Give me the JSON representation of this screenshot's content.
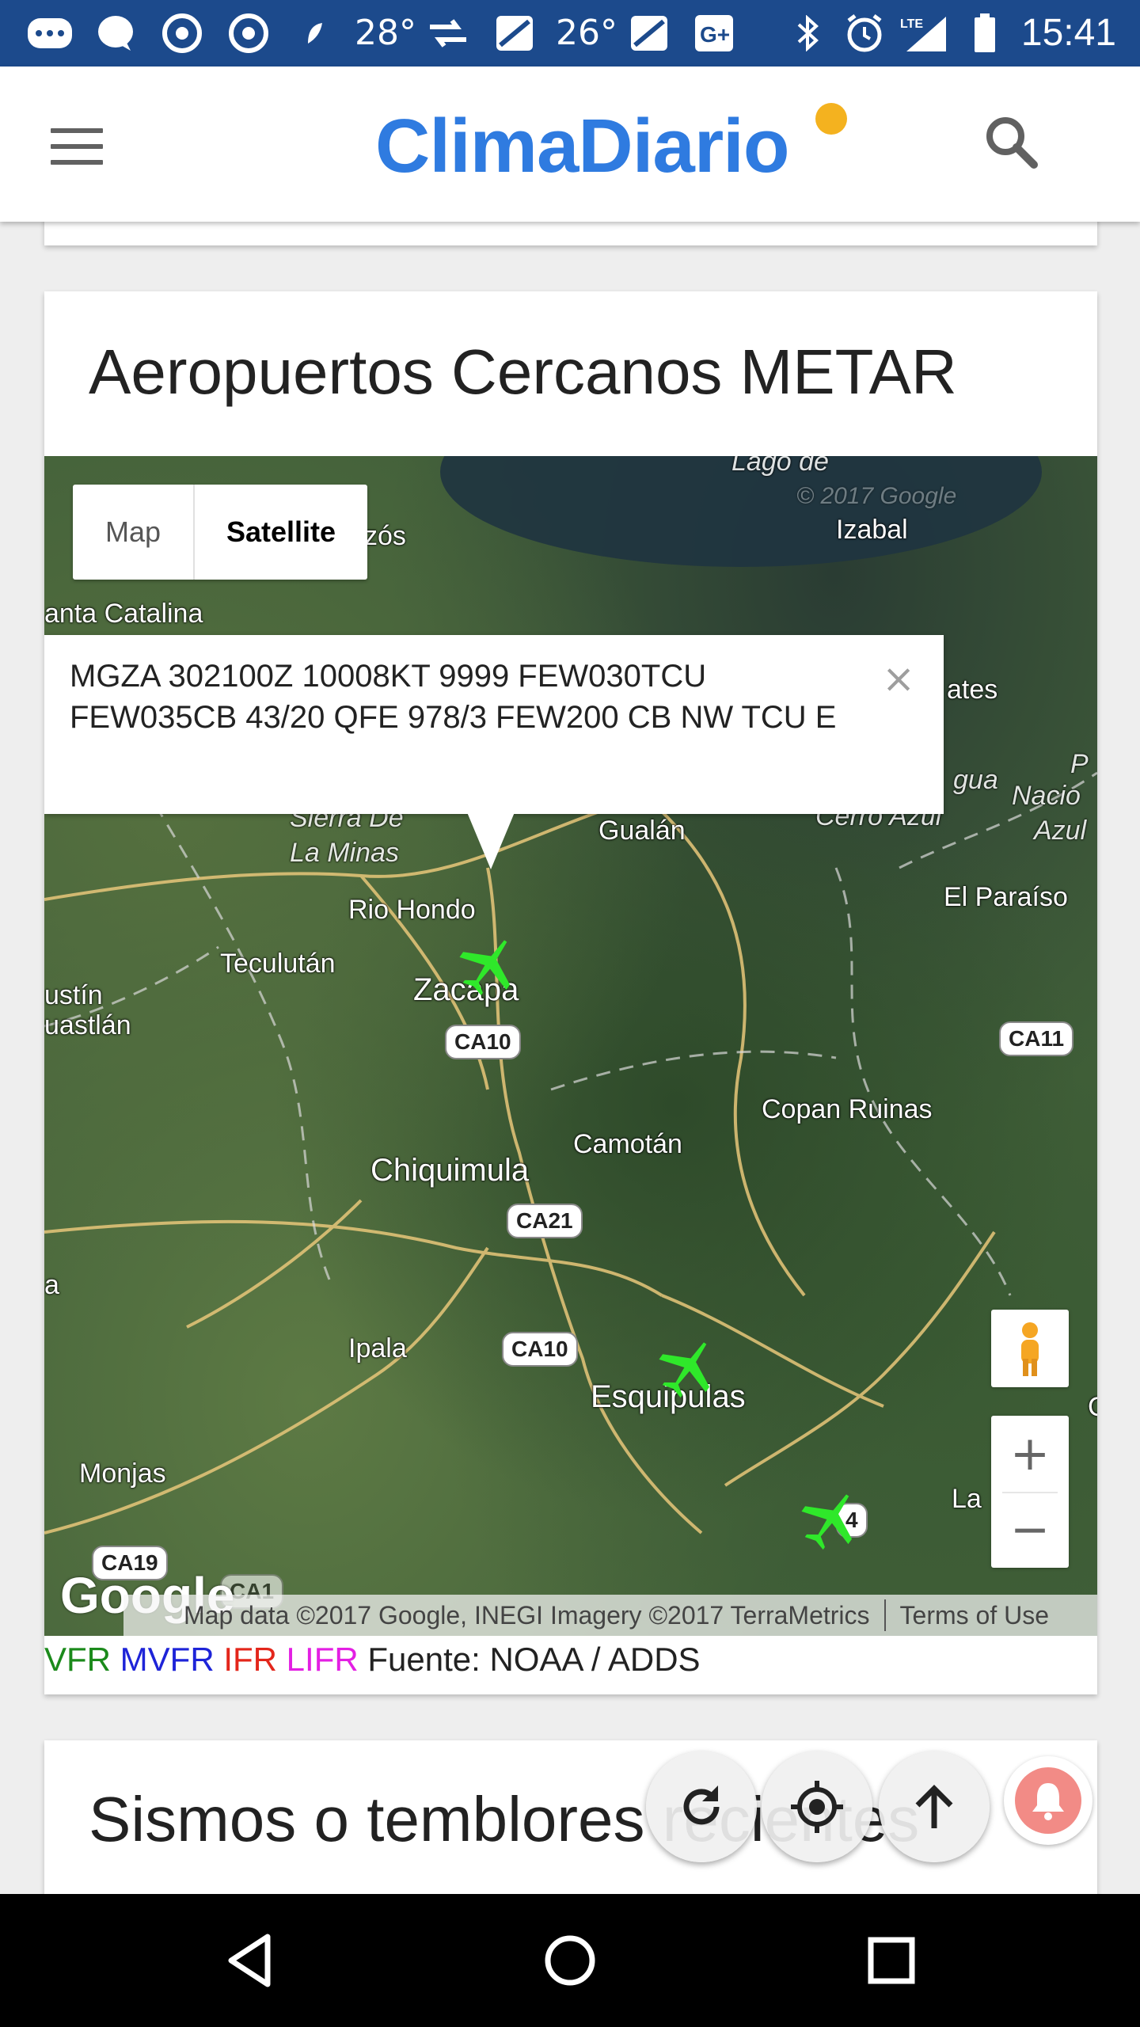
{
  "status_bar": {
    "temp1": "28°",
    "temp2": "26°",
    "time": "15:41",
    "icons": [
      "messages-icon",
      "chat-icon",
      "chrome-icon",
      "chrome-icon",
      "leaf-icon",
      "sync-icon",
      "maps-icon",
      "maps-icon",
      "google-plus-icon",
      "bluetooth-icon",
      "alarm-icon",
      "lte-signal-icon",
      "battery-icon"
    ]
  },
  "app_bar": {
    "logo": "ClimaDiario",
    "menu_icon": "menu-icon",
    "search_icon": "search-icon",
    "brand_color": "#2f7be0",
    "logo_dot_color": "#f4b21f"
  },
  "metar_card": {
    "title": "Aeropuertos Cercanos METAR",
    "map_type": {
      "map": "Map",
      "satellite": "Satellite",
      "selected": "Satellite"
    },
    "info_window": {
      "text": "MGZA 302100Z 10008KT 9999 FEW030TCU FEW035CB 43/20 QFE 978/3 FEW200 CB NW TCU E",
      "close": "×"
    },
    "places": {
      "lago": "Lago de",
      "watermark": "© 2017 Google",
      "izabal": "Izabal",
      "zos": "zós",
      "santa_catalina": "anta Catalina",
      "ates": "ates",
      "gua": "gua",
      "cerro_azul": "Cerro Azul",
      "pn1": "P",
      "nacio": "Nacio",
      "azul": "Azul",
      "sierra_de": "Sierra De",
      "la_minas": "La Minas",
      "gualan": "Gualán",
      "el_paraiso": "El Paraíso",
      "rio_hondo": "Rio Hondo",
      "teculutan": "Teculután",
      "zacapa": "Zacapa",
      "ustin": "ustín",
      "uastlan": "uastlán",
      "ca10_a": "CA10",
      "ca11": "CA11",
      "copan_ruinas": "Copan Ruinas",
      "camotan": "Camotán",
      "chiquimula": "Chiquimula",
      "ca21": "CA21",
      "a_left": "a",
      "ipala": "Ipala",
      "ca10_b": "CA10",
      "esquipulas": "Esquipulas",
      "c_right": "C",
      "monjas": "Monjas",
      "la": "La",
      "four": "4",
      "ca19": "CA19",
      "ca1": "CA1"
    },
    "attribution": "Map data ©2017 Google, INEGI Imagery ©2017 TerraMetrics",
    "terms": "Terms of Use",
    "google_logo": "Google",
    "zoom_in": "+",
    "zoom_out": "−",
    "legend": {
      "vfr": "VFR",
      "mvfr": "MVFR",
      "ifr": "IFR",
      "lifr": "LIFR",
      "source": "Fuente: NOAA / ADDS",
      "colors": {
        "vfr": "#1b8a1b",
        "mvfr": "#1e24d8",
        "ifr": "#e3261b",
        "lifr": "#e31fe3"
      }
    }
  },
  "sismos_card": {
    "title": "Sismos o temblores recientes"
  },
  "fabs": [
    "refresh-icon",
    "locate-icon",
    "scroll-top-icon",
    "notification-bell-icon"
  ],
  "nav_bar": [
    "back-icon",
    "home-icon",
    "recents-icon"
  ]
}
